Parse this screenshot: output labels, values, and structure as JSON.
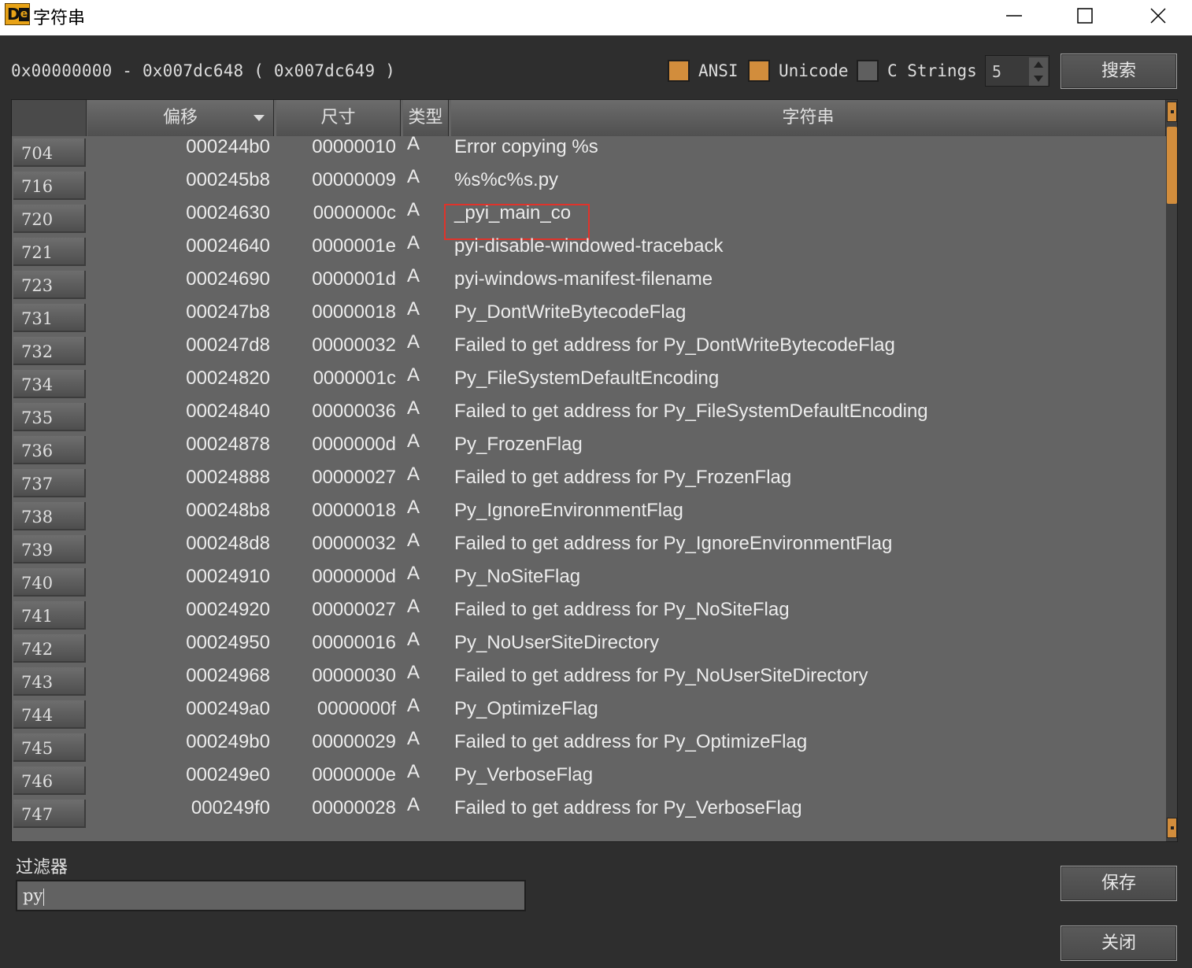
{
  "window": {
    "title": "字符串"
  },
  "toolbar": {
    "range": "0x00000000 - 0x007dc648 ( 0x007dc649 )",
    "ansi_label": "ANSI",
    "ansi_checked": true,
    "unicode_label": "Unicode",
    "unicode_checked": true,
    "cstrings_label": "C Strings",
    "cstrings_checked": false,
    "min_length": "5",
    "search_label": "搜索"
  },
  "table": {
    "columns": {
      "offset": "偏移",
      "size": "尺寸",
      "type": "类型",
      "string": "字符串"
    },
    "sort_column": "offset",
    "rows": [
      {
        "num": "704",
        "offset": "000244b0",
        "size": "00000010",
        "type": "A",
        "string": "Error copying %s"
      },
      {
        "num": "716",
        "offset": "000245b8",
        "size": "00000009",
        "type": "A",
        "string": "%s%c%s.py"
      },
      {
        "num": "720",
        "offset": "00024630",
        "size": "0000000c",
        "type": "A",
        "string": "_pyi_main_co",
        "highlighted": true
      },
      {
        "num": "721",
        "offset": "00024640",
        "size": "0000001e",
        "type": "A",
        "string": "pyi-disable-windowed-traceback"
      },
      {
        "num": "723",
        "offset": "00024690",
        "size": "0000001d",
        "type": "A",
        "string": "pyi-windows-manifest-filename"
      },
      {
        "num": "731",
        "offset": "000247b8",
        "size": "00000018",
        "type": "A",
        "string": "Py_DontWriteBytecodeFlag"
      },
      {
        "num": "732",
        "offset": "000247d8",
        "size": "00000032",
        "type": "A",
        "string": "Failed to get address for Py_DontWriteBytecodeFlag"
      },
      {
        "num": "734",
        "offset": "00024820",
        "size": "0000001c",
        "type": "A",
        "string": "Py_FileSystemDefaultEncoding"
      },
      {
        "num": "735",
        "offset": "00024840",
        "size": "00000036",
        "type": "A",
        "string": "Failed to get address for Py_FileSystemDefaultEncoding"
      },
      {
        "num": "736",
        "offset": "00024878",
        "size": "0000000d",
        "type": "A",
        "string": "Py_FrozenFlag"
      },
      {
        "num": "737",
        "offset": "00024888",
        "size": "00000027",
        "type": "A",
        "string": "Failed to get address for Py_FrozenFlag"
      },
      {
        "num": "738",
        "offset": "000248b8",
        "size": "00000018",
        "type": "A",
        "string": "Py_IgnoreEnvironmentFlag"
      },
      {
        "num": "739",
        "offset": "000248d8",
        "size": "00000032",
        "type": "A",
        "string": "Failed to get address for Py_IgnoreEnvironmentFlag"
      },
      {
        "num": "740",
        "offset": "00024910",
        "size": "0000000d",
        "type": "A",
        "string": "Py_NoSiteFlag"
      },
      {
        "num": "741",
        "offset": "00024920",
        "size": "00000027",
        "type": "A",
        "string": "Failed to get address for Py_NoSiteFlag"
      },
      {
        "num": "742",
        "offset": "00024950",
        "size": "00000016",
        "type": "A",
        "string": "Py_NoUserSiteDirectory"
      },
      {
        "num": "743",
        "offset": "00024968",
        "size": "00000030",
        "type": "A",
        "string": "Failed to get address for Py_NoUserSiteDirectory"
      },
      {
        "num": "744",
        "offset": "000249a0",
        "size": "0000000f",
        "type": "A",
        "string": "Py_OptimizeFlag"
      },
      {
        "num": "745",
        "offset": "000249b0",
        "size": "00000029",
        "type": "A",
        "string": "Failed to get address for Py_OptimizeFlag"
      },
      {
        "num": "746",
        "offset": "000249e0",
        "size": "0000000e",
        "type": "A",
        "string": "Py_VerboseFlag"
      },
      {
        "num": "747",
        "offset": "000249f0",
        "size": "00000028",
        "type": "A",
        "string": "Failed to get address for Py_VerboseFlag"
      }
    ]
  },
  "filter": {
    "label": "过滤器",
    "value": "py"
  },
  "actions": {
    "save_label": "保存",
    "close_label": "关闭"
  },
  "colors": {
    "accent": "#d28d3c",
    "highlight_border": "#e0332b",
    "background": "#2e2e2e",
    "table_bg": "#646464"
  }
}
